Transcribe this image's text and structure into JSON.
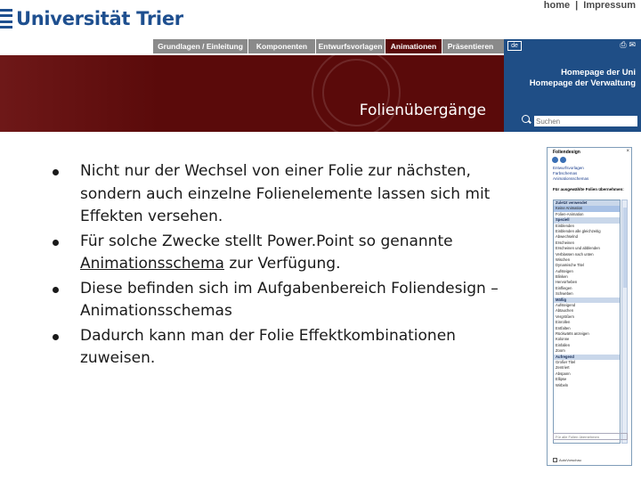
{
  "header": {
    "logo_text": "Universität Trier",
    "top_links": {
      "home": "home",
      "separator": "|",
      "impressum": "Impressum"
    },
    "nav": [
      {
        "label": "Grundlagen / Einleitung",
        "active": false
      },
      {
        "label": "Komponenten",
        "active": false
      },
      {
        "label": "Entwurfsvorlagen",
        "active": false
      },
      {
        "label": "Animationen",
        "active": true
      },
      {
        "label": "Präsentieren",
        "active": false
      }
    ],
    "banner_title": "Folienübergänge",
    "side": {
      "lang": "de",
      "link1": "Homepage der Uni",
      "link2": "Homepage der Verwaltung",
      "search_placeholder": "Suchen"
    }
  },
  "bullets": [
    {
      "text": "Nicht nur der Wechsel von einer Folie zur nächsten, sondern auch einzelne Folien­elemente lassen sich mit Effekten versehen."
    },
    {
      "pre": "Für solche Zwecke stellt Power.Point so genannte ",
      "link": "Animationsschema",
      "post": " zur Verfügung."
    },
    {
      "text": "Diese befinden sich im Aufgabenbereich Foliendesign – Animationsschemas"
    },
    {
      "text": "Dadurch kann man der Folie Effekt­kombinationen zuweisen."
    }
  ],
  "task_pane": {
    "title": "Foliendesign",
    "close": "×",
    "links": [
      "Entwurfsvorlagen",
      "Farbschemas",
      "Animationsschemas"
    ],
    "heading": "Für ausgewählte Folien übernehmen:",
    "items": [
      {
        "label": "Zuletzt verwendet",
        "kind": "cat"
      },
      {
        "label": "Keine Animation",
        "kind": "sel"
      },
      {
        "label": "Folien-Animation",
        "kind": "item"
      },
      {
        "label": "Speziell",
        "kind": "cat"
      },
      {
        "label": "Einblenden",
        "kind": "item"
      },
      {
        "label": "Einblenden alle gleichzeitig",
        "kind": "item"
      },
      {
        "label": "Abwechselnd",
        "kind": "item"
      },
      {
        "label": "Erscheinen",
        "kind": "item"
      },
      {
        "label": "Erscheinen und abblenden",
        "kind": "item"
      },
      {
        "label": "Verblassen nach unten",
        "kind": "item"
      },
      {
        "label": "Wischen",
        "kind": "item"
      },
      {
        "label": "Dynamische Titel",
        "kind": "item"
      },
      {
        "label": "Aufsteigen",
        "kind": "item"
      },
      {
        "label": "Blinken",
        "kind": "item"
      },
      {
        "label": "Hervorheben",
        "kind": "item"
      },
      {
        "label": "Einfliegen",
        "kind": "item"
      },
      {
        "label": "Schweben",
        "kind": "item"
      },
      {
        "label": "Mäßig",
        "kind": "cat"
      },
      {
        "label": "Aufsteigend",
        "kind": "item"
      },
      {
        "label": "Abtauchen",
        "kind": "item"
      },
      {
        "label": "Vergrößern",
        "kind": "item"
      },
      {
        "label": "Einrollen",
        "kind": "item"
      },
      {
        "label": "Entfalten",
        "kind": "item"
      },
      {
        "label": "Rückwärts anzeigen",
        "kind": "item"
      },
      {
        "label": "Kolonne",
        "kind": "item"
      },
      {
        "label": "Einfallen",
        "kind": "item"
      },
      {
        "label": "Zoom",
        "kind": "item"
      },
      {
        "label": "Aufregend",
        "kind": "cat"
      },
      {
        "label": "Großer Titel",
        "kind": "item"
      },
      {
        "label": "Zentriert",
        "kind": "item"
      },
      {
        "label": "Abspann",
        "kind": "item"
      },
      {
        "label": "Ellipse",
        "kind": "item"
      },
      {
        "label": "Wirbeln",
        "kind": "item"
      }
    ],
    "apply_all": "Für alle Folien übernehmen",
    "autopreview": "AutoVorschau"
  }
}
